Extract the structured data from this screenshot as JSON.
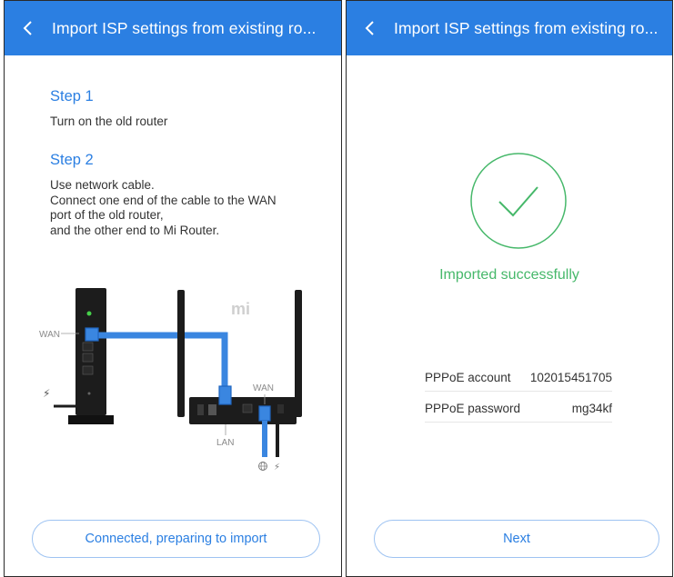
{
  "left_screen": {
    "header": {
      "title": "Import ISP settings from existing ro...",
      "back_icon": "chevron-left-icon"
    },
    "step1": {
      "title": "Step 1",
      "text": "Turn on the old router"
    },
    "step2": {
      "title": "Step 2",
      "lines": [
        "Use network cable.",
        "Connect one end of the cable to the WAN",
        "port of the old router,",
        "and the other end to Mi Router."
      ]
    },
    "illustration": {
      "wan_label_old": "WAN",
      "wan_label_new": "WAN",
      "lan_label": "LAN",
      "brand_logo": "mi",
      "power_icon": "lightning-icon",
      "globe_icon": "globe-icon"
    },
    "button_label": "Connected, preparing to import"
  },
  "right_screen": {
    "header": {
      "title": "Import ISP settings from existing ro...",
      "back_icon": "chevron-left-icon"
    },
    "status": "Imported successfully",
    "account": {
      "label": "PPPoE account",
      "value": "102015451705"
    },
    "password": {
      "label": "PPPoE password",
      "value": "mg34kf"
    },
    "button_label": "Next"
  },
  "colors": {
    "accent": "#2b7fe2",
    "success": "#46b86a",
    "cable": "#3a86e0",
    "router_dark": "#1c1c1c"
  }
}
